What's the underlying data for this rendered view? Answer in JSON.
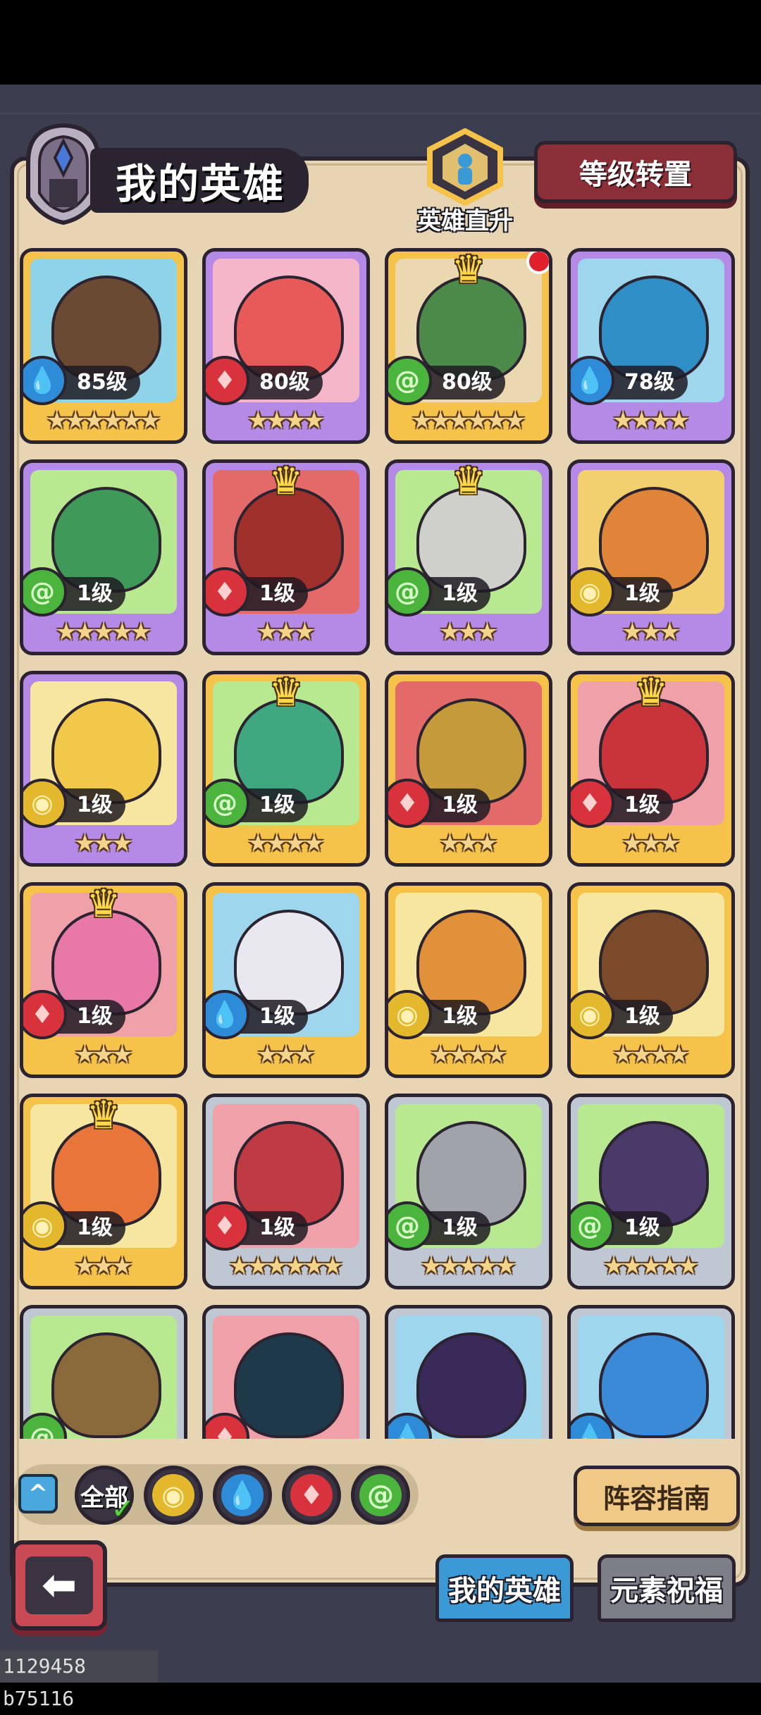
{
  "header": {
    "title": "我的英雄",
    "promote_label": "英雄直升",
    "level_transfer_label": "等级转置"
  },
  "colors": {
    "water": "#2e8bd8",
    "fire": "#d8333d",
    "wind": "#4bb43c",
    "earth": "#e4b82c",
    "gold_frame": "#f5c24a",
    "purple_frame": "#b48ae6",
    "silver_frame": "#bfc8d2"
  },
  "heroes": [
    {
      "level": "85级",
      "element": "water",
      "stars": 6,
      "rarity": "gold",
      "crown": false,
      "portrait": "#6b4a34",
      "bg": "#8fd3e8"
    },
    {
      "level": "80级",
      "element": "fire",
      "stars": 4,
      "rarity": "purple",
      "crown": false,
      "portrait": "#e85a5a",
      "bg": "#f4b6c8"
    },
    {
      "level": "80级",
      "element": "wind",
      "stars": 6,
      "rarity": "gold",
      "crown": true,
      "reddot": true,
      "portrait": "#4c8a4a",
      "bg": "#e9d8b0"
    },
    {
      "level": "78级",
      "element": "water",
      "stars": 4,
      "rarity": "purple",
      "crown": false,
      "portrait": "#2f8ec6",
      "bg": "#9ed6ee"
    },
    {
      "level": "1级",
      "element": "wind",
      "stars": 5,
      "rarity": "purple",
      "crown": false,
      "portrait": "#3f9a5a",
      "bg": "#b8e890"
    },
    {
      "level": "1级",
      "element": "fire",
      "stars": 3,
      "rarity": "purple",
      "crown": true,
      "portrait": "#a0302c",
      "bg": "#e46a6a"
    },
    {
      "level": "1级",
      "element": "wind",
      "stars": 3,
      "rarity": "purple",
      "crown": true,
      "portrait": "#cfd0cc",
      "bg": "#b8e890"
    },
    {
      "level": "1级",
      "element": "earth",
      "stars": 3,
      "rarity": "purple",
      "crown": false,
      "portrait": "#e0843a",
      "bg": "#f2d070"
    },
    {
      "level": "1级",
      "element": "earth",
      "stars": 3,
      "rarity": "purple",
      "crown": false,
      "portrait": "#f2c84a",
      "bg": "#f6e6a0"
    },
    {
      "level": "1级",
      "element": "wind",
      "stars": 4,
      "rarity": "gold",
      "crown": true,
      "portrait": "#3fa880",
      "bg": "#b8e890"
    },
    {
      "level": "1级",
      "element": "fire",
      "stars": 3,
      "rarity": "gold",
      "crown": false,
      "portrait": "#c49a3a",
      "bg": "#e46a6a"
    },
    {
      "level": "1级",
      "element": "fire",
      "stars": 3,
      "rarity": "gold",
      "crown": true,
      "portrait": "#c8343a",
      "bg": "#f0a0a8"
    },
    {
      "level": "1级",
      "element": "fire",
      "stars": 3,
      "rarity": "gold",
      "crown": true,
      "portrait": "#e878a8",
      "bg": "#f0a0a8"
    },
    {
      "level": "1级",
      "element": "water",
      "stars": 3,
      "rarity": "gold",
      "crown": false,
      "portrait": "#e8e8ee",
      "bg": "#9ed6ee"
    },
    {
      "level": "1级",
      "element": "earth",
      "stars": 4,
      "rarity": "gold",
      "crown": false,
      "portrait": "#e0913a",
      "bg": "#f6e6a0"
    },
    {
      "level": "1级",
      "element": "earth",
      "stars": 4,
      "rarity": "gold",
      "crown": false,
      "portrait": "#7a4a2a",
      "bg": "#f6e6a0"
    },
    {
      "level": "1级",
      "element": "earth",
      "stars": 3,
      "rarity": "gold",
      "crown": true,
      "portrait": "#e8763a",
      "bg": "#f6e6a0"
    },
    {
      "level": "1级",
      "element": "fire",
      "stars": 6,
      "rarity": "silver",
      "crown": false,
      "portrait": "#c03a44",
      "bg": "#f0a0a8"
    },
    {
      "level": "1级",
      "element": "wind",
      "stars": 5,
      "rarity": "silver",
      "crown": false,
      "portrait": "#a0a4aa",
      "bg": "#b8e890"
    },
    {
      "level": "1级",
      "element": "wind",
      "stars": 5,
      "rarity": "silver",
      "crown": false,
      "portrait": "#4a3a6a",
      "bg": "#b8e890"
    },
    {
      "level": "",
      "element": "wind",
      "stars": 0,
      "rarity": "silver",
      "crown": false,
      "portrait": "#8a6a3a",
      "bg": "#b8e890"
    },
    {
      "level": "",
      "element": "fire",
      "stars": 0,
      "rarity": "silver",
      "crown": false,
      "portrait": "#1e3a4a",
      "bg": "#f0a0a8"
    },
    {
      "level": "",
      "element": "water",
      "stars": 0,
      "rarity": "silver",
      "crown": false,
      "portrait": "#3a2a5a",
      "bg": "#9ed6ee"
    },
    {
      "level": "",
      "element": "water",
      "stars": 0,
      "rarity": "silver",
      "crown": false,
      "portrait": "#3a8ad8",
      "bg": "#9ed6ee"
    }
  ],
  "filter": {
    "all_label": "全部",
    "elements": [
      "earth",
      "water",
      "fire",
      "wind"
    ]
  },
  "buttons": {
    "lineup_guide": "阵容指南"
  },
  "tabs": {
    "my_heroes": "我的英雄",
    "element_blessing": "元素祝福"
  },
  "build_id": "1129458 b75116"
}
